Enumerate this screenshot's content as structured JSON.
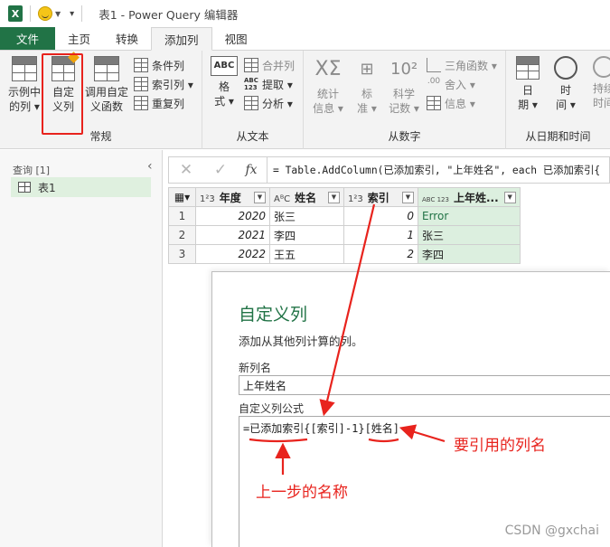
{
  "window": {
    "title": "表1 - Power Query 编辑器",
    "app_icon_letter": "X"
  },
  "tabs": [
    {
      "label": "文件"
    },
    {
      "label": "主页"
    },
    {
      "label": "转换"
    },
    {
      "label": "添加列"
    },
    {
      "label": "视图"
    }
  ],
  "ribbon": {
    "general": {
      "group_label": "常规",
      "example_col": [
        "示例中",
        "的列 ▾"
      ],
      "custom_col": [
        "自定",
        "义列"
      ],
      "invoke_func": [
        "调用自定",
        "义函数"
      ],
      "conditional": "条件列",
      "index": "索引列 ▾",
      "duplicate": "重复列"
    },
    "text": {
      "group_label": "从文本",
      "format": [
        "格",
        "式 ▾"
      ],
      "merge": "合并列",
      "extract": "提取 ▾",
      "parse": "分析 ▾"
    },
    "number": {
      "group_label": "从数字",
      "stats": [
        "统计",
        "信息 ▾"
      ],
      "standard": [
        "标",
        "准 ▾"
      ],
      "scientific": [
        "科学",
        "记数 ▾"
      ],
      "trig": "三角函数 ▾",
      "round": "舍入 ▾",
      "info": "信息 ▾"
    },
    "datetime": {
      "group_label": "从日期和时间",
      "date": [
        "日",
        "期 ▾"
      ],
      "time": [
        "时",
        "间 ▾"
      ],
      "duration": [
        "持续",
        "时间"
      ]
    }
  },
  "queries": {
    "header": "查询 [1]",
    "items": [
      {
        "label": "表1"
      }
    ]
  },
  "formula_bar": {
    "text": "= Table.AddColumn(已添加索引, \"上年姓名\", each 已添加索引{"
  },
  "table": {
    "columns": [
      {
        "type": "1²3",
        "name": "年度"
      },
      {
        "type": "AᴮC",
        "name": "姓名"
      },
      {
        "type": "1²3",
        "name": "索引"
      },
      {
        "type": "ABC 123",
        "name": "上年姓..."
      }
    ],
    "rows": [
      {
        "n": "1",
        "year": "2020",
        "name": "张三",
        "idx": "0",
        "prev": "Error"
      },
      {
        "n": "2",
        "year": "2021",
        "name": "李四",
        "idx": "1",
        "prev": "张三"
      },
      {
        "n": "3",
        "year": "2022",
        "name": "王五",
        "idx": "2",
        "prev": "李四"
      }
    ]
  },
  "dialog": {
    "title": "自定义列",
    "subtitle": "添加从其他列计算的列。",
    "new_col_label": "新列名",
    "new_col_value": "上年姓名",
    "formula_label": "自定义列公式",
    "formula": "=已添加索引{[索引]-1}[姓名]"
  },
  "annotations": {
    "ref_column": "要引用的列名",
    "prev_step": "上一步的名称"
  },
  "watermark": "CSDN @gxchai",
  "colors": {
    "excel_green": "#217346",
    "annotation_red": "#e8231d",
    "new_col_bg": "#dcefdf"
  }
}
